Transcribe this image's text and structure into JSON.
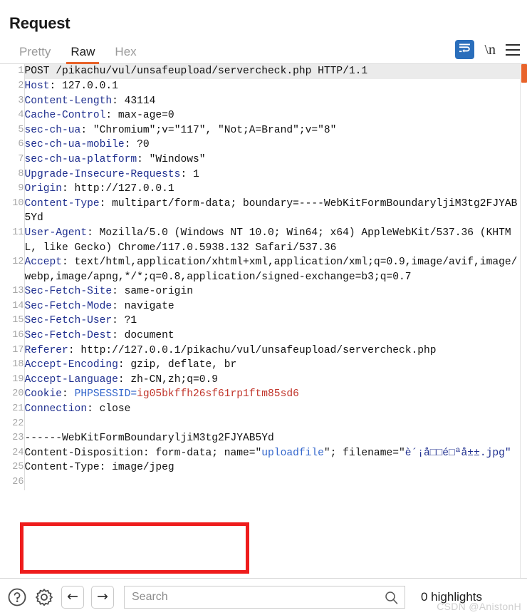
{
  "panel": {
    "title": "Request"
  },
  "tabs": [
    {
      "label": "Pretty",
      "active": false
    },
    {
      "label": "Raw",
      "active": true
    },
    {
      "label": "Hex",
      "active": false
    }
  ],
  "toolbar": {
    "wrap_icon": "word-wrap-icon",
    "newline_label": "\\n",
    "menu_icon": "hamburger-menu-icon",
    "accent_color": "#e8632a",
    "wrap_button_color": "#2a6ebb"
  },
  "code": {
    "lines": [
      {
        "num": "1",
        "highlight": true,
        "spans": [
          {
            "t": "POST /pikachu/vul/unsafeupload/servercheck.php HTTP/1.1",
            "c": "kv"
          }
        ]
      },
      {
        "num": "2",
        "spans": [
          {
            "t": "Host",
            "c": "k"
          },
          {
            "t": ": 127.0.0.1",
            "c": "kv"
          }
        ]
      },
      {
        "num": "3",
        "spans": [
          {
            "t": "Content-Length",
            "c": "k"
          },
          {
            "t": ": 43114",
            "c": "kv"
          }
        ]
      },
      {
        "num": "4",
        "spans": [
          {
            "t": "Cache-Control",
            "c": "k"
          },
          {
            "t": ": max-age=0",
            "c": "kv"
          }
        ]
      },
      {
        "num": "5",
        "spans": [
          {
            "t": "sec-ch-ua",
            "c": "k"
          },
          {
            "t": ": \"Chromium\";v=\"117\", \"Not;A=Brand\";v=\"8\"",
            "c": "kv"
          }
        ]
      },
      {
        "num": "6",
        "spans": [
          {
            "t": "sec-ch-ua-mobile",
            "c": "k"
          },
          {
            "t": ": ?0",
            "c": "kv"
          }
        ]
      },
      {
        "num": "7",
        "spans": [
          {
            "t": "sec-ch-ua-platform",
            "c": "k"
          },
          {
            "t": ": \"Windows\"",
            "c": "kv"
          }
        ]
      },
      {
        "num": "8",
        "spans": [
          {
            "t": "Upgrade-Insecure-Requests",
            "c": "k"
          },
          {
            "t": ": 1",
            "c": "kv"
          }
        ]
      },
      {
        "num": "9",
        "spans": [
          {
            "t": "Origin",
            "c": "k"
          },
          {
            "t": ": http://127.0.0.1",
            "c": "kv"
          }
        ]
      },
      {
        "num": "10",
        "spans": [
          {
            "t": "Content-Type",
            "c": "k"
          },
          {
            "t": ": multipart/form-data; boundary=----WebKitFormBoundaryljiM3tg2FJYAB5Yd",
            "c": "kv"
          }
        ]
      },
      {
        "num": "11",
        "spans": [
          {
            "t": "User-Agent",
            "c": "k"
          },
          {
            "t": ": Mozilla/5.0 (Windows NT 10.0; Win64; x64) AppleWebKit/537.36 (KHTML, like Gecko) Chrome/117.0.5938.132 Safari/537.36",
            "c": "kv"
          }
        ]
      },
      {
        "num": "12",
        "spans": [
          {
            "t": "Accept",
            "c": "k"
          },
          {
            "t": ": text/html,application/xhtml+xml,application/xml;q=0.9,image/avif,image/webp,image/apng,*/*;q=0.8,application/signed-exchange=b3;q=0.7",
            "c": "kv"
          }
        ]
      },
      {
        "num": "13",
        "spans": [
          {
            "t": "Sec-Fetch-Site",
            "c": "k"
          },
          {
            "t": ": same-origin",
            "c": "kv"
          }
        ]
      },
      {
        "num": "14",
        "spans": [
          {
            "t": "Sec-Fetch-Mode",
            "c": "k"
          },
          {
            "t": ": navigate",
            "c": "kv"
          }
        ]
      },
      {
        "num": "15",
        "spans": [
          {
            "t": "Sec-Fetch-User",
            "c": "k"
          },
          {
            "t": ": ?1",
            "c": "kv"
          }
        ]
      },
      {
        "num": "16",
        "spans": [
          {
            "t": "Sec-Fetch-Dest",
            "c": "k"
          },
          {
            "t": ": document",
            "c": "kv"
          }
        ]
      },
      {
        "num": "17",
        "spans": [
          {
            "t": "Referer",
            "c": "k"
          },
          {
            "t": ": http://127.0.0.1/pikachu/vul/unsafeupload/servercheck.php",
            "c": "kv"
          }
        ]
      },
      {
        "num": "18",
        "spans": [
          {
            "t": "Accept-Encoding",
            "c": "k"
          },
          {
            "t": ": gzip, deflate, br",
            "c": "kv"
          }
        ]
      },
      {
        "num": "19",
        "spans": [
          {
            "t": "Accept-Language",
            "c": "k"
          },
          {
            "t": ": zh-CN,zh;q=0.9",
            "c": "kv"
          }
        ]
      },
      {
        "num": "20",
        "spans": [
          {
            "t": "Cookie",
            "c": "k"
          },
          {
            "t": ": ",
            "c": "kv"
          },
          {
            "t": "PHPSESSID=",
            "c": "b2"
          },
          {
            "t": "ig05bkffh26sf61rp1ftm85sd6",
            "c": "rd"
          }
        ]
      },
      {
        "num": "21",
        "spans": [
          {
            "t": "Connection",
            "c": "k"
          },
          {
            "t": ": close",
            "c": "kv"
          }
        ]
      },
      {
        "num": "22",
        "spans": [
          {
            "t": "",
            "c": "kv"
          }
        ]
      },
      {
        "num": "23",
        "spans": [
          {
            "t": "------WebKitFormBoundaryljiM3tg2FJYAB5Yd",
            "c": "kv"
          }
        ]
      },
      {
        "num": "24",
        "spans": [
          {
            "t": "Content-Disposition: form-data; name=\"",
            "c": "kv"
          },
          {
            "t": "uploadfile",
            "c": "b2"
          },
          {
            "t": "\"; filename=\"",
            "c": "kv"
          },
          {
            "t": "è´¡å□□é□ªå±±.jpg\"",
            "c": "k"
          }
        ]
      },
      {
        "num": "25",
        "spans": [
          {
            "t": "Content-Type: image/jpeg",
            "c": "kv"
          }
        ]
      },
      {
        "num": "26",
        "spans": [
          {
            "t": "",
            "c": "kv"
          }
        ]
      }
    ]
  },
  "annotation": {
    "name": "red-highlight-box",
    "color": "#ee1c1c"
  },
  "bottom": {
    "help_icon": "help-circle-icon",
    "settings_icon": "gear-icon",
    "back_label": "←",
    "forward_label": "→",
    "search_value": "",
    "search_placeholder": "Search",
    "search_icon": "magnifier-icon",
    "highlights_label": "0 highlights"
  },
  "watermark": {
    "text": "CSDN @AnistonH"
  }
}
